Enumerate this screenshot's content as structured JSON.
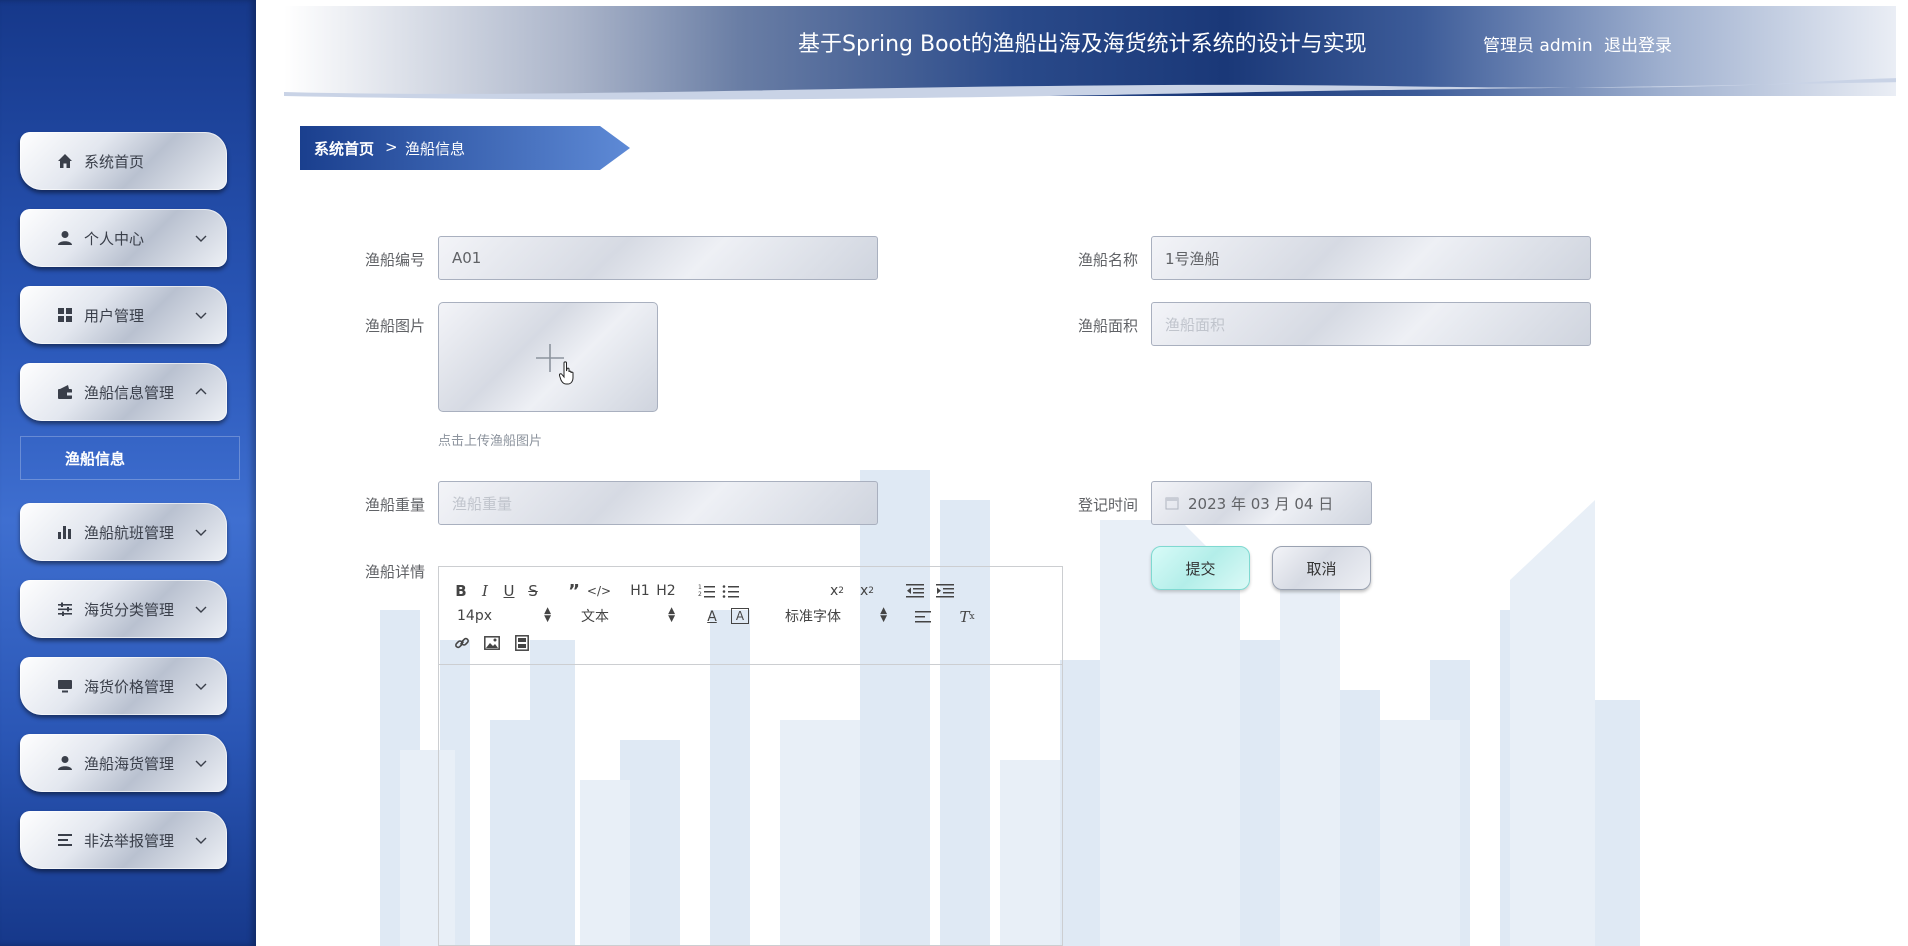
{
  "header": {
    "title": "基于Spring Boot的渔船出海及海货统计系统的设计与实现",
    "user": "管理员 admin",
    "logout": "退出登录"
  },
  "sidebar": {
    "items": [
      {
        "label": "系统首页",
        "icon": "home-icon",
        "chevron": ""
      },
      {
        "label": "个人中心",
        "icon": "user-icon",
        "chevron": "down"
      },
      {
        "label": "用户管理",
        "icon": "grid-icon",
        "chevron": "down"
      },
      {
        "label": "渔船信息管理",
        "icon": "wallet-icon",
        "chevron": "up"
      },
      {
        "label": "渔船航班管理",
        "icon": "bar-chart-icon",
        "chevron": "down"
      },
      {
        "label": "海货分类管理",
        "icon": "sliders-icon",
        "chevron": "down"
      },
      {
        "label": "海货价格管理",
        "icon": "monitor-icon",
        "chevron": "down"
      },
      {
        "label": "渔船海货管理",
        "icon": "user-icon",
        "chevron": "down"
      },
      {
        "label": "非法举报管理",
        "icon": "list-icon",
        "chevron": "down"
      }
    ],
    "sub_item": "渔船信息"
  },
  "breadcrumb": {
    "home": "系统首页",
    "separator": ">",
    "current": "渔船信息"
  },
  "form": {
    "boat_no": {
      "label": "渔船编号",
      "value": "A01"
    },
    "boat_name": {
      "label": "渔船名称",
      "value": "1号渔船"
    },
    "boat_image": {
      "label": "渔船图片",
      "tip": "点击上传渔船图片"
    },
    "boat_area": {
      "label": "渔船面积",
      "placeholder": "渔船面积"
    },
    "boat_weight": {
      "label": "渔船重量",
      "placeholder": "渔船重量"
    },
    "register_time": {
      "label": "登记时间",
      "value": "2023 年 03 月 04 日"
    },
    "boat_detail": {
      "label": "渔船详情"
    },
    "submit": "提交",
    "cancel": "取消"
  },
  "editor": {
    "font_size": "14px",
    "paragraph": "文本",
    "font_family": "标准字体",
    "h1": "H1",
    "h2": "H2"
  },
  "colors": {
    "sidebar_blue": "#2a57b8",
    "breadcrumb_blue": "#1f4a9c",
    "submit_teal": "#b3eee9"
  }
}
